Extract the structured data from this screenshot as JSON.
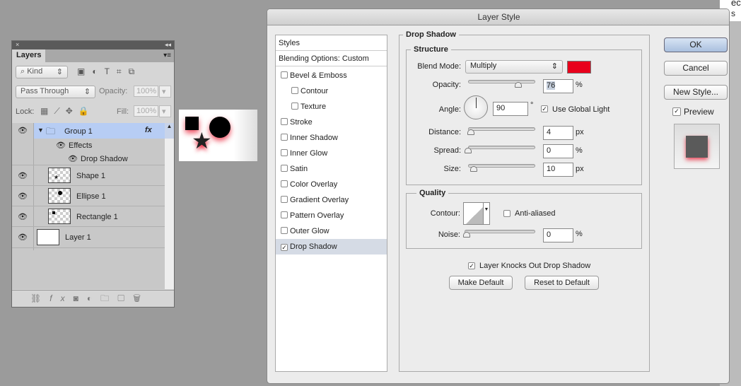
{
  "layers_panel": {
    "close": "×",
    "collapse": "◂◂",
    "tab": "Layers",
    "menu": "▾≡",
    "filter_kind": "Kind",
    "blend_mode": "Pass Through",
    "opacity_label": "Opacity:",
    "opacity": "100%",
    "lock_label": "Lock:",
    "fill_label": "Fill:",
    "fill": "100%",
    "layers": [
      {
        "name": "Group 1",
        "fx": "fx",
        "selected": true
      },
      {
        "name": "Effects"
      },
      {
        "name": "Drop Shadow"
      },
      {
        "name": "Shape 1"
      },
      {
        "name": "Ellipse 1"
      },
      {
        "name": "Rectangle 1"
      },
      {
        "name": "Layer 1"
      }
    ]
  },
  "dialog": {
    "title": "Layer Style",
    "styles": [
      {
        "label": "Styles"
      },
      {
        "label": "Blending Options: Custom"
      },
      {
        "label": "Bevel & Emboss",
        "checked": false
      },
      {
        "label": "Contour",
        "checked": false
      },
      {
        "label": "Texture",
        "checked": false
      },
      {
        "label": "Stroke",
        "checked": false
      },
      {
        "label": "Inner Shadow",
        "checked": false
      },
      {
        "label": "Inner Glow",
        "checked": false
      },
      {
        "label": "Satin",
        "checked": false
      },
      {
        "label": "Color Overlay",
        "checked": false
      },
      {
        "label": "Gradient Overlay",
        "checked": false
      },
      {
        "label": "Pattern Overlay",
        "checked": false
      },
      {
        "label": "Outer Glow",
        "checked": false
      },
      {
        "label": "Drop Shadow",
        "checked": true,
        "selected": true
      }
    ],
    "section": "Drop Shadow",
    "structure": "Structure",
    "blend_mode_label": "Blend Mode:",
    "blend_mode": "Multiply",
    "shadow_color": "#e8001b",
    "opacity_label": "Opacity:",
    "opacity": "76",
    "opacity_unit": "%",
    "angle_label": "Angle:",
    "angle": "90",
    "angle_unit": "°",
    "use_global_light": "Use Global Light",
    "use_global_light_checked": true,
    "distance_label": "Distance:",
    "distance": "4",
    "distance_unit": "px",
    "spread_label": "Spread:",
    "spread": "0",
    "spread_unit": "%",
    "size_label": "Size:",
    "size": "10",
    "size_unit": "px",
    "quality": "Quality",
    "contour_label": "Contour:",
    "anti_aliased": "Anti-aliased",
    "anti_aliased_checked": false,
    "noise_label": "Noise:",
    "noise": "0",
    "noise_unit": "%",
    "knockout": "Layer Knocks Out Drop Shadow",
    "knockout_checked": true,
    "make_default": "Make Default",
    "reset_default": "Reset to Default",
    "ok": "OK",
    "cancel": "Cancel",
    "new_style": "New Style...",
    "preview": "Preview",
    "preview_checked": true
  },
  "background_text": {
    "line1": "ec",
    "line2": "s"
  }
}
